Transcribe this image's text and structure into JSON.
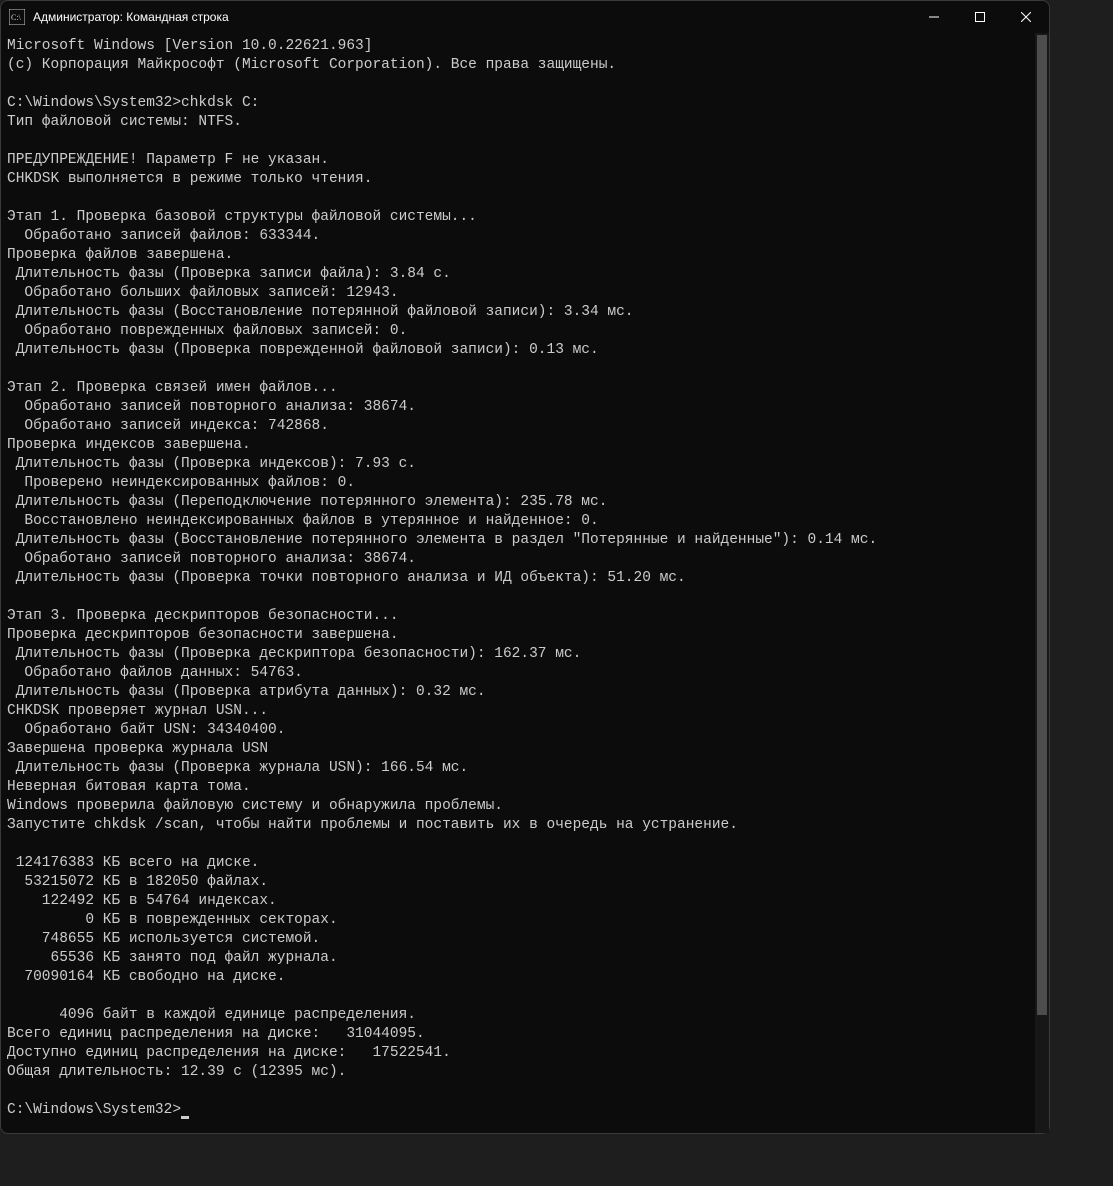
{
  "window": {
    "title": "Администратор: Командная строка"
  },
  "terminal": {
    "lines": [
      "Microsoft Windows [Version 10.0.22621.963]",
      "(c) Корпорация Майкрософт (Microsoft Corporation). Все права защищены.",
      "",
      "C:\\Windows\\System32>chkdsk C:",
      "Тип файловой системы: NTFS.",
      "",
      "ПРЕДУПРЕЖДЕНИЕ! Параметр F не указан.",
      "CHKDSK выполняется в режиме только чтения.",
      "",
      "Этап 1. Проверка базовой структуры файловой системы...",
      "  Обработано записей файлов: 633344.",
      "Проверка файлов завершена.",
      " Длительность фазы (Проверка записи файла): 3.84 с.",
      "  Обработано больших файловых записей: 12943.",
      " Длительность фазы (Восстановление потерянной файловой записи): 3.34 мс.",
      "  Обработано поврежденных файловых записей: 0.",
      " Длительность фазы (Проверка поврежденной файловой записи): 0.13 мс.",
      "",
      "Этап 2. Проверка связей имен файлов...",
      "  Обработано записей повторного анализа: 38674.",
      "  Обработано записей индекса: 742868.",
      "Проверка индексов завершена.",
      " Длительность фазы (Проверка индексов): 7.93 с.",
      "  Проверено неиндексированных файлов: 0.",
      " Длительность фазы (Переподключение потерянного элемента): 235.78 мс.",
      "  Восстановлено неиндексированных файлов в утерянное и найденное: 0.",
      " Длительность фазы (Восстановление потерянного элемента в раздел \"Потерянные и найденные\"): 0.14 мс.",
      "  Обработано записей повторного анализа: 38674.",
      " Длительность фазы (Проверка точки повторного анализа и ИД объекта): 51.20 мс.",
      "",
      "Этап 3. Проверка дескрипторов безопасности...",
      "Проверка дескрипторов безопасности завершена.",
      " Длительность фазы (Проверка дескриптора безопасности): 162.37 мс.",
      "  Обработано файлов данных: 54763.",
      " Длительность фазы (Проверка атрибута данных): 0.32 мс.",
      "CHKDSK проверяет журнал USN...",
      "  Обработано байт USN: 34340400.",
      "Завершена проверка журнала USN",
      " Длительность фазы (Проверка журнала USN): 166.54 мс.",
      "Неверная битовая карта тома.",
      "Windows проверила файловую систему и обнаружила проблемы.",
      "Запустите chkdsk /scan, чтобы найти проблемы и поставить их в очередь на устранение.",
      "",
      " 124176383 КБ всего на диске.",
      "  53215072 КБ в 182050 файлах.",
      "    122492 КБ в 54764 индексах.",
      "         0 КБ в поврежденных секторах.",
      "    748655 КБ используется системой.",
      "     65536 КБ занято под файл журнала.",
      "  70090164 КБ свободно на диске.",
      "",
      "      4096 байт в каждой единице распределения.",
      "Всего единиц распределения на диске:   31044095.",
      "Доступно единиц распределения на диске:   17522541.",
      "Общая длительность: 12.39 с (12395 мс).",
      "",
      "C:\\Windows\\System32>"
    ]
  }
}
